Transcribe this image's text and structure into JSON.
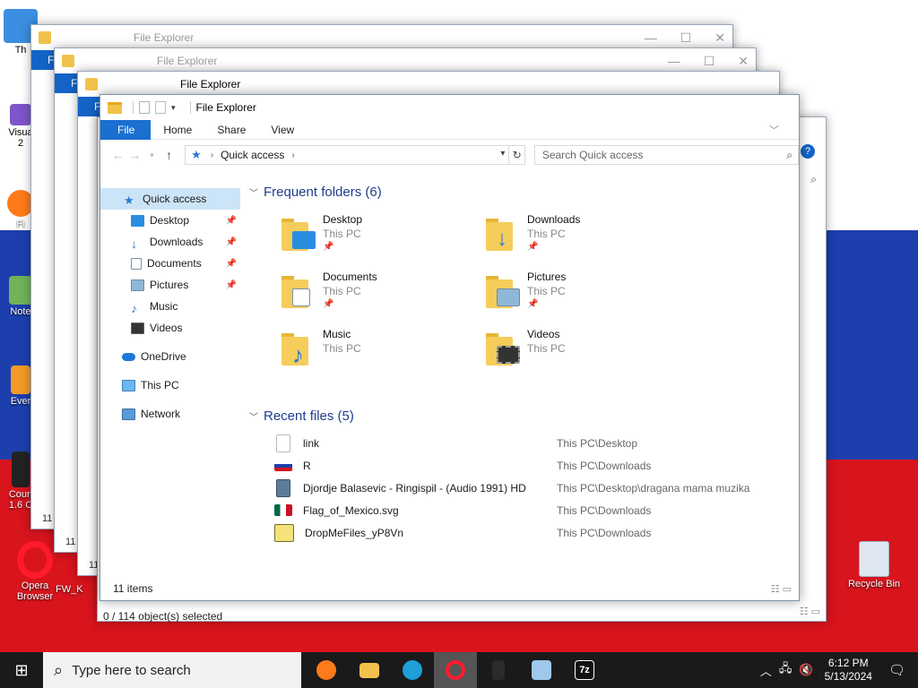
{
  "desktop": {
    "icons": [
      {
        "label": "Th"
      },
      {
        "label": "Visua\n2"
      },
      {
        "label": "Fi"
      },
      {
        "label": "Note"
      },
      {
        "label": "Ever"
      },
      {
        "label": "Coun\n1.6 C"
      },
      {
        "label": "Opera\nBrowser"
      },
      {
        "label": "FW_K"
      },
      {
        "label": "Recycle Bin"
      }
    ]
  },
  "window": {
    "title": "File Explorer",
    "ribbon_tabs": [
      "File",
      "Home",
      "Share",
      "View"
    ],
    "address": {
      "location": "Quick access"
    },
    "search_placeholder": "Search Quick access",
    "nav": [
      {
        "label": "Quick access",
        "pinned": false
      },
      {
        "label": "Desktop",
        "pinned": true
      },
      {
        "label": "Downloads",
        "pinned": true
      },
      {
        "label": "Documents",
        "pinned": true
      },
      {
        "label": "Pictures",
        "pinned": true
      },
      {
        "label": "Music",
        "pinned": false
      },
      {
        "label": "Videos",
        "pinned": false
      },
      {
        "label": "OneDrive",
        "pinned": false
      },
      {
        "label": "This PC",
        "pinned": false
      },
      {
        "label": "Network",
        "pinned": false
      }
    ],
    "frequent_header": "Frequent folders (6)",
    "frequent": [
      {
        "name": "Desktop",
        "location": "This PC"
      },
      {
        "name": "Downloads",
        "location": "This PC"
      },
      {
        "name": "Documents",
        "location": "This PC"
      },
      {
        "name": "Pictures",
        "location": "This PC"
      },
      {
        "name": "Music",
        "location": "This PC"
      },
      {
        "name": "Videos",
        "location": "This PC"
      }
    ],
    "recent_header": "Recent files (5)",
    "recent": [
      {
        "name": "link",
        "path": "This PC\\Desktop"
      },
      {
        "name": "R",
        "path": "This PC\\Downloads"
      },
      {
        "name": "Djordje Balasevic - Ringispil - (Audio 1991) HD",
        "path": "This PC\\Desktop\\dragana mama muzika"
      },
      {
        "name": "Flag_of_Mexico.svg",
        "path": "This PC\\Downloads"
      },
      {
        "name": "DropMeFiles_yP8Vn",
        "path": "This PC\\Downloads"
      }
    ],
    "status": "11 items"
  },
  "back_windows": {
    "title": "File Explorer",
    "file_tab": "File",
    "item_count": "11",
    "selection_status": "0 / 114 object(s) selected"
  },
  "taskbar": {
    "search_placeholder": "Type here to search",
    "time": "6:12 PM",
    "date": "5/13/2024"
  }
}
